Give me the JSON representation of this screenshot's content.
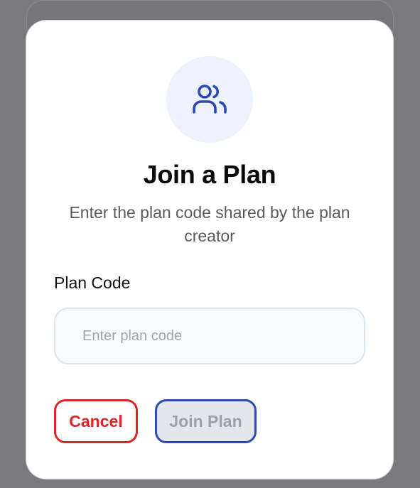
{
  "modal": {
    "icon": "users-icon",
    "title": "Join a Plan",
    "subtitle": "Enter the plan code shared by the plan creator",
    "field": {
      "label": "Plan Code",
      "value": "",
      "placeholder": "Enter plan code"
    },
    "buttons": {
      "cancel_label": "Cancel",
      "join_label": "Join Plan",
      "join_disabled": true
    }
  },
  "colors": {
    "accent": "#2b4bb3",
    "danger": "#dc2626",
    "icon_bg": "#eef0fb"
  }
}
